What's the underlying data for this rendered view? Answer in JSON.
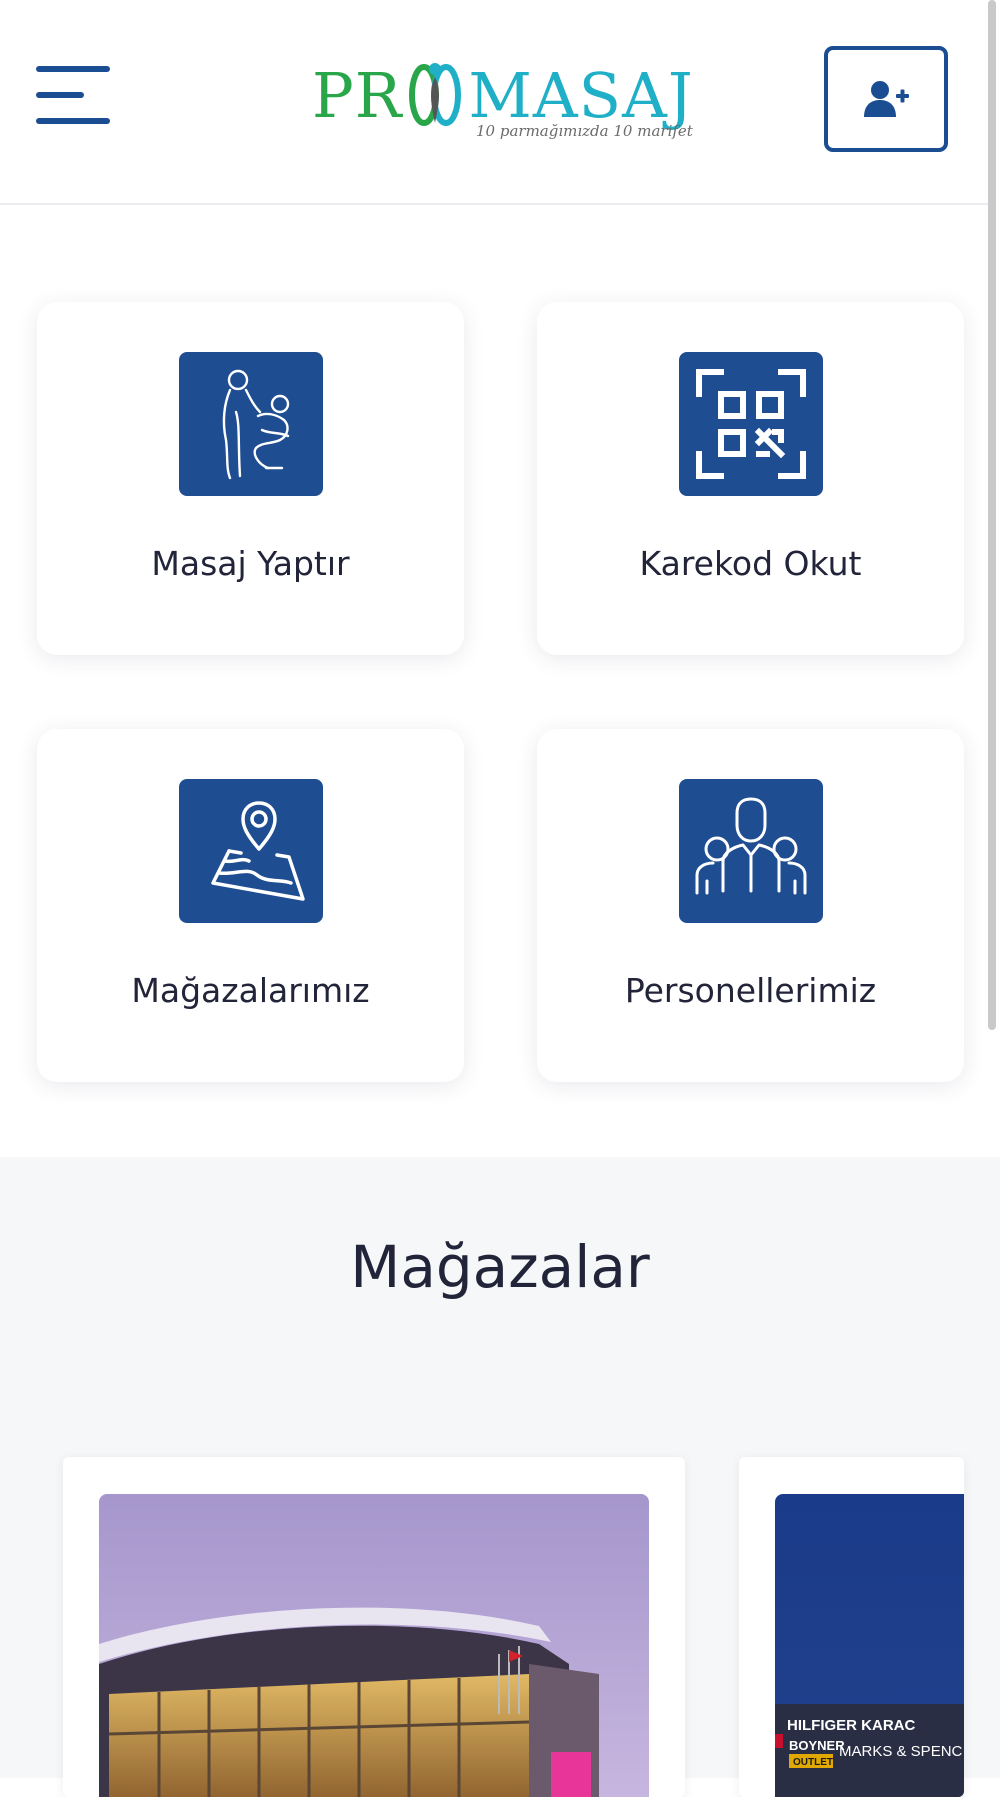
{
  "header": {
    "menu_icon": "hamburger-menu-icon",
    "logo_text_left": "PR",
    "logo_text_right": "MASAJ",
    "logo_tagline": "10 parmağımızda 10 marifet",
    "register_icon": "user-plus-icon"
  },
  "tiles": [
    {
      "label": "Masaj Yaptır",
      "icon": "massage-icon"
    },
    {
      "label": "Karekod Okut",
      "icon": "qr-code-icon"
    },
    {
      "label": "Mağazalarımız",
      "icon": "map-pin-icon"
    },
    {
      "label": "Personellerimiz",
      "icon": "people-group-icon"
    }
  ],
  "stores": {
    "title": "Mağazalar",
    "cards": [
      {
        "image": "mall-building-photo"
      },
      {
        "image": "outlet-storefront-photo",
        "signage": [
          "HILFIGER KARAC",
          "BOYNER",
          "OUTLET",
          "MARKS & SPENC"
        ]
      }
    ]
  },
  "colors": {
    "brand_blue": "#1e4d92",
    "logo_green": "#2aa64a",
    "logo_teal": "#1fb0c8",
    "section_bg": "#f6f7f9"
  }
}
